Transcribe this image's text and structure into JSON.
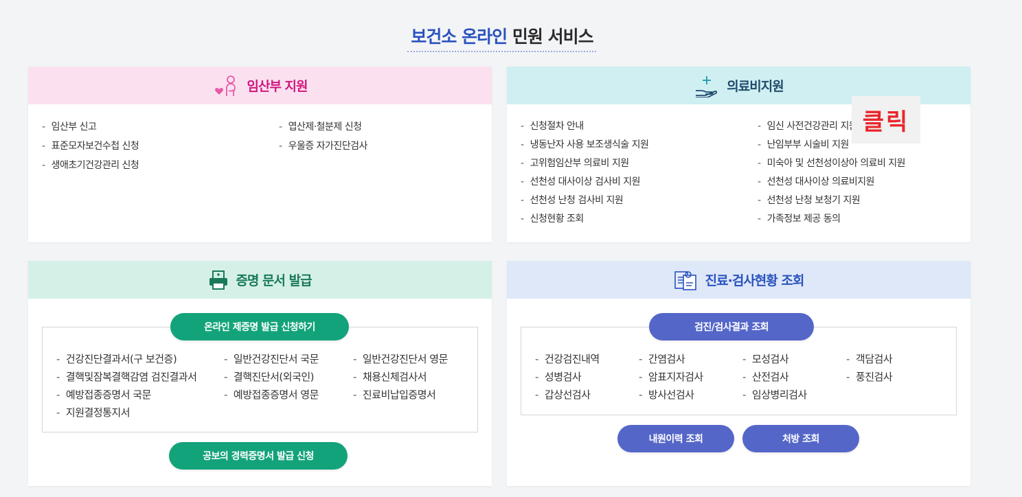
{
  "page": {
    "title_accent": "보건소 온라인",
    "title_rest": "민원 서비스"
  },
  "pregnant": {
    "title": "임산부 지원",
    "col1": [
      "임산부 신고",
      "표준모자보건수첩 신청",
      "생애초기건강관리 신청"
    ],
    "col2": [
      "엽산제·철분제 신청",
      "우울증 자가진단검사"
    ]
  },
  "medical": {
    "title": "의료비지원",
    "col1": [
      "신청절차 안내",
      "냉동난자 사용 보조생식술 지원",
      "고위험임산부 의료비 지원",
      "선천성 대사이상 검사비 지원",
      "선천성 난청 검사비 지원",
      "신청현황 조회"
    ],
    "col2": [
      "임신 사전건강관리 지원",
      "난임부부 시술비 지원",
      "미숙아 및 선천성이상아 의료비 지원",
      "선천성 대사이상 의료비지원",
      "선천성 난청 보청기 지원",
      "가족정보 제공 동의"
    ],
    "click_badge": "클릭"
  },
  "certificate": {
    "title": "증명 문서 발급",
    "top_button": "온라인 제증명 발급 신청하기",
    "col1": [
      "건강진단결과서(구 보건증)",
      "결핵및잠복결핵감염 검진결과서",
      "예방접종증명서 국문",
      "지원결정통지서"
    ],
    "col2": [
      "일반건강진단서 국문",
      "결핵진단서(외국인)",
      "예방접종증명서 영문"
    ],
    "col3": [
      "일반건강진단서 영문",
      "채용신체검사서",
      "진료비납입증명서"
    ],
    "bottom_button": "공보의 경력증명서 발급 신청"
  },
  "exam": {
    "title": "진료·검사현황 조회",
    "top_button": "검진/검사결과 조회",
    "col1": [
      "건강검진내역",
      "성병검사",
      "갑상선검사"
    ],
    "col2": [
      "간염검사",
      "암표지자검사",
      "방사선검사"
    ],
    "col3": [
      "모성검사",
      "산전검사",
      "임상병리검사"
    ],
    "col4": [
      "객담검사",
      "풍진검사"
    ],
    "button_visits": "내원이력 조회",
    "button_prescription": "처방 조회"
  },
  "colors": {
    "accent_blue": "#2a52be",
    "pink_head": "#fbe1f0",
    "pink_text": "#d1177f",
    "teal_head": "#cfeff2",
    "green_head": "#d5f1e7",
    "green_button": "#13a37a",
    "blue_head": "#dee8f9",
    "blue_button": "#5566c9",
    "click_red": "#e8262a"
  }
}
